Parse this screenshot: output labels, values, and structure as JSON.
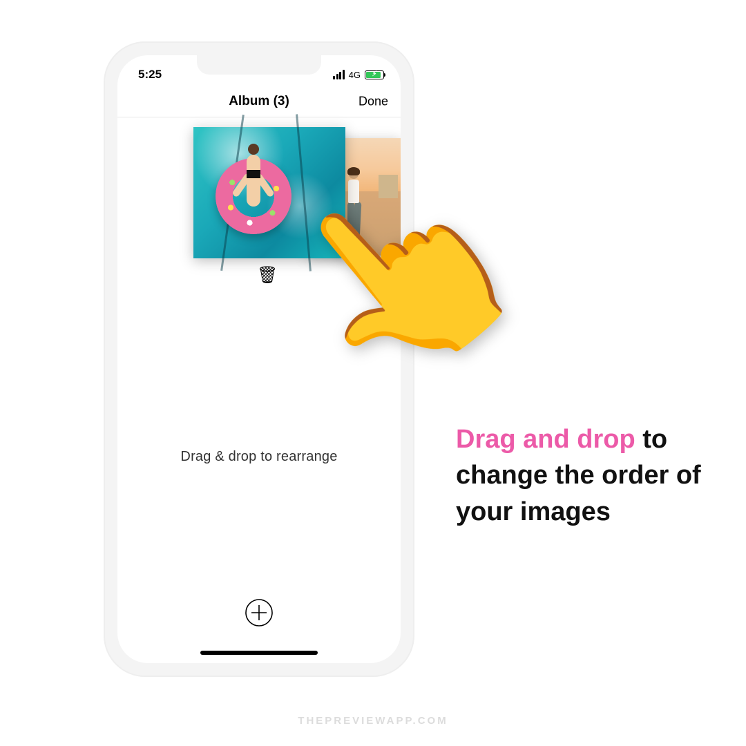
{
  "statusbar": {
    "time": "5:25",
    "network": "4G"
  },
  "navbar": {
    "title": "Album (3)",
    "done": "Done"
  },
  "album": {
    "hint": "Drag & drop to rearrange",
    "trash_glyph": "🗑"
  },
  "hand_glyph": "👆",
  "caption": {
    "highlight": "Drag and drop",
    "rest": " to change the order of your images"
  },
  "watermark": "THEPREVIEWAPP.COM"
}
